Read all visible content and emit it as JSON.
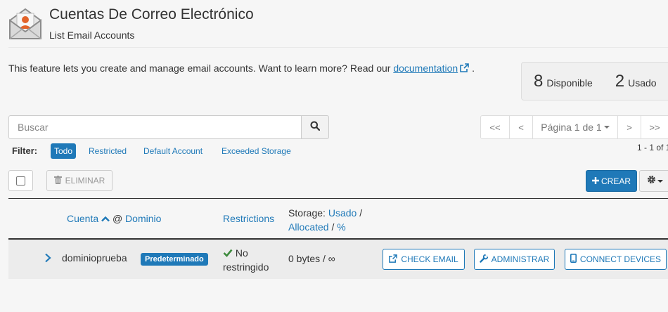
{
  "header": {
    "title": "Cuentas De Correo Electrónico",
    "subtitle": "List Email Accounts",
    "icon": "email-envelope-user-icon"
  },
  "intro": {
    "text": "This feature lets you create and manage email accounts. Want to learn more? Read our ",
    "link_label": "documentation",
    "suffix": "."
  },
  "stats": {
    "available_count": "8",
    "available_label": "Disponible",
    "used_count": "2",
    "used_label": "Usado"
  },
  "search": {
    "placeholder": "Buscar",
    "value": ""
  },
  "pagination": {
    "first": "<<",
    "prev": "<",
    "page_label": "Página 1 de 1",
    "next": ">",
    "last": ">>",
    "range": "1 - 1 of 1"
  },
  "filter": {
    "label": "Filter:",
    "options": [
      "Todo",
      "Restricted",
      "Default Account",
      "Exceeded Storage"
    ],
    "active": "Todo"
  },
  "toolbar": {
    "delete_label": "ELIMINAR",
    "create_label": "CREAR"
  },
  "table": {
    "col_account": "Cuenta",
    "col_at": "@",
    "col_domain": "Dominio",
    "col_restrictions": "Restrictions",
    "col_storage_prefix": "Storage:",
    "col_storage_used": "Usado",
    "col_storage_slash1": "/",
    "col_storage_allocated": "Allocated",
    "col_storage_slash2": "/",
    "col_storage_percent": "%",
    "rows": [
      {
        "account": "dominioprueba",
        "badge": "Predeterminado",
        "restriction_line1": "No",
        "restriction_line2": "restringido",
        "storage": "0 bytes / ∞",
        "check_email": "CHECK EMAIL",
        "manage": "ADMINISTRAR",
        "connect": "CONNECT DEVICES"
      }
    ]
  },
  "colors": {
    "accent": "#1f79b8",
    "success": "#3d8a3d",
    "brand_orange": "#e2632a"
  }
}
